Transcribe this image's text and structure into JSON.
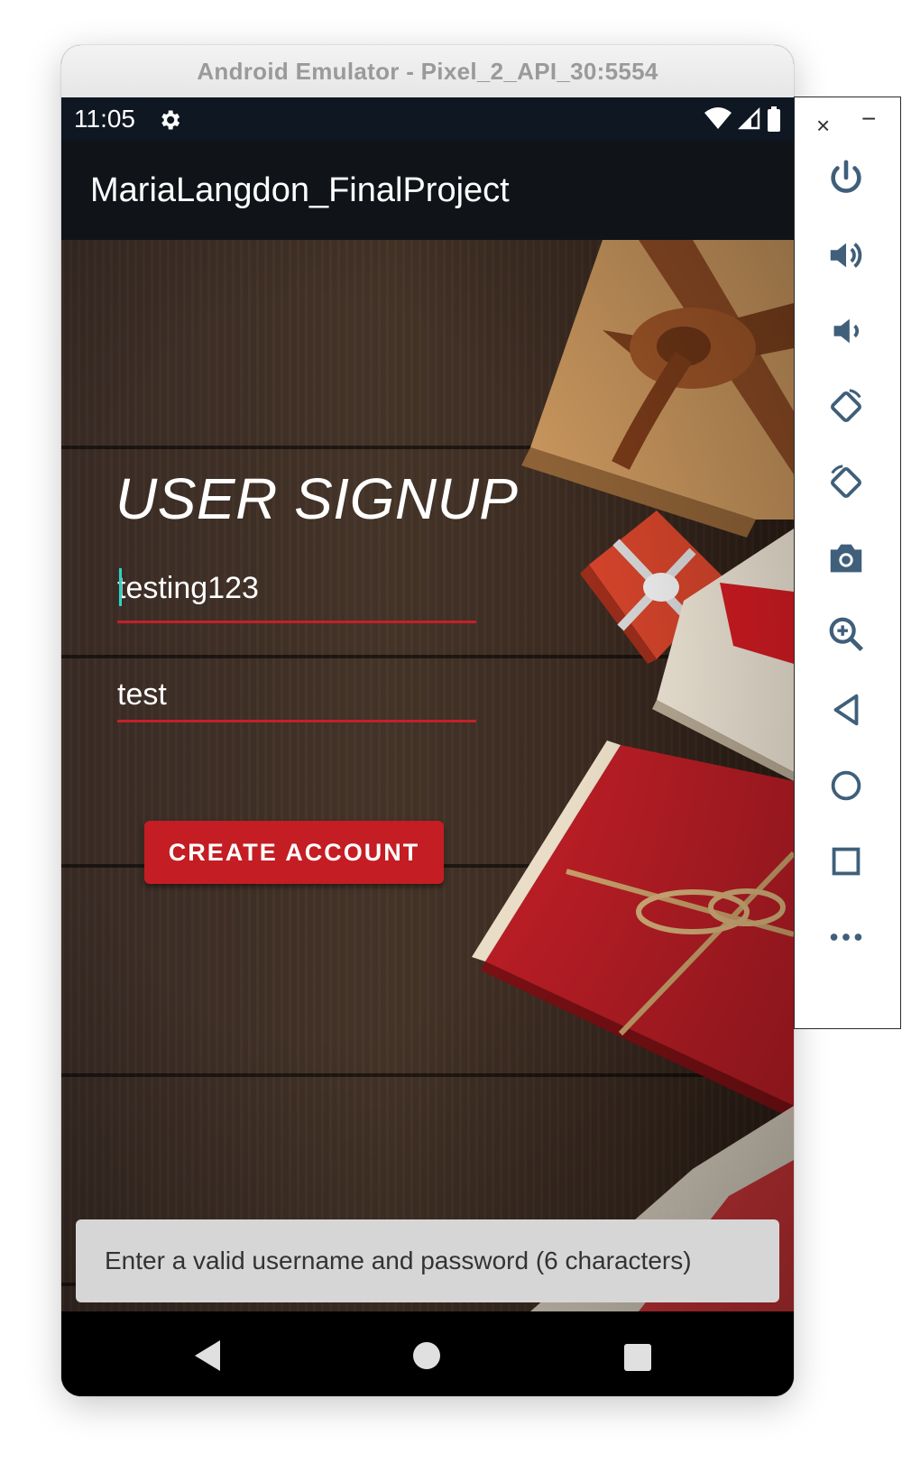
{
  "window": {
    "title": "Android Emulator - Pixel_2_API_30:5554"
  },
  "status_bar": {
    "time": "11:05"
  },
  "app_bar": {
    "title": "MariaLangdon_FinalProject"
  },
  "signup": {
    "heading": "USER SIGNUP",
    "username_value": "testing123",
    "password_value": "test",
    "create_button": "CREATE ACCOUNT"
  },
  "toast": {
    "message": "Enter a valid username and password (6 characters)"
  },
  "colors": {
    "accent": "#c41d23",
    "appbar": "#101419",
    "statusbar": "#0e1722",
    "caret": "#2ed3c4"
  },
  "sidebar": {
    "close": "×",
    "minimize": "−",
    "buttons": [
      "power-icon",
      "volume-up-icon",
      "volume-down-icon",
      "rotate-left-icon",
      "rotate-right-icon",
      "camera-icon",
      "zoom-icon",
      "back-icon",
      "home-icon",
      "overview-icon",
      "more-icon"
    ]
  }
}
